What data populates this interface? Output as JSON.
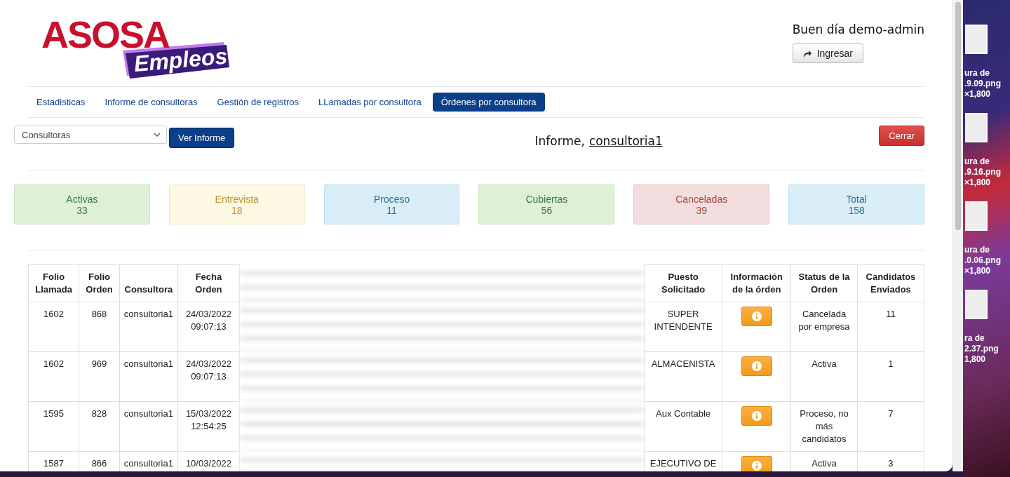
{
  "logo": {
    "top": "ASOSA",
    "bottom": "Empleos"
  },
  "greeting": "Buen día demo-admin",
  "login_button": "Ingresar",
  "tabs": [
    {
      "label": "Estadisticas",
      "selected": false
    },
    {
      "label": "Informe de consultoras",
      "selected": false
    },
    {
      "label": "Gestión de registros",
      "selected": false
    },
    {
      "label": "LLamadas por consultora",
      "selected": false
    },
    {
      "label": "Órdenes por consultora",
      "selected": true
    }
  ],
  "select": {
    "value": "Consultoras"
  },
  "view_button": "Ver Informe",
  "report_title": {
    "prefix": "Informe,",
    "name": "consultoria1"
  },
  "close_button": "Cerrar",
  "stats": [
    {
      "label": "Activas",
      "value": "33",
      "kind": "success"
    },
    {
      "label": "Entrevista",
      "value": "18",
      "kind": "warning"
    },
    {
      "label": "Proceso",
      "value": "11",
      "kind": "info"
    },
    {
      "label": "Cubiertas",
      "value": "56",
      "kind": "success"
    },
    {
      "label": "Canceladas",
      "value": "39",
      "kind": "danger"
    },
    {
      "label": "Total",
      "value": "158",
      "kind": "info"
    }
  ],
  "table": {
    "columns_left": [
      "Folio Llamada",
      "Folio Orden",
      "Consultora",
      "Fecha Orden"
    ],
    "columns_right": [
      "Puesto Solicitado",
      "Información de la órden",
      "Status de la Orden",
      "Candidatos Enviados"
    ],
    "rows": [
      {
        "folio_llamada": "1602",
        "folio_orden": "868",
        "consultora": "consultoria1",
        "fecha": "24/03/2022 09:07:13",
        "puesto": "SUPER INTENDENTE",
        "status": "Cancelada por empresa",
        "candidatos": "11"
      },
      {
        "folio_llamada": "1602",
        "folio_orden": "969",
        "consultora": "consultoria1",
        "fecha": "24/03/2022 09:07:13",
        "puesto": "ALMACENISTA",
        "status": "Activa",
        "candidatos": "1"
      },
      {
        "folio_llamada": "1595",
        "folio_orden": "828",
        "consultora": "consultoria1",
        "fecha": "15/03/2022 12:54:25",
        "puesto": "Aux Contable",
        "status": "Proceso, no más candidatos",
        "candidatos": "7"
      },
      {
        "folio_llamada": "1587",
        "folio_orden": "866",
        "consultora": "consultoria1",
        "fecha": "10/03/2022",
        "puesto": "EJECUTIVO DE",
        "status": "Activa",
        "candidatos": "3"
      }
    ]
  },
  "desktop_files": [
    {
      "lines": [
        "ura de",
        ".9.09.png",
        "×1,800"
      ]
    },
    {
      "lines": [
        "ura de",
        ".9.16.png",
        "×1,800"
      ]
    },
    {
      "lines": [
        "ura de",
        ".0.06.png",
        "×1,800"
      ]
    },
    {
      "lines": [
        "ra de",
        "2.37.png",
        "1,800"
      ]
    }
  ]
}
